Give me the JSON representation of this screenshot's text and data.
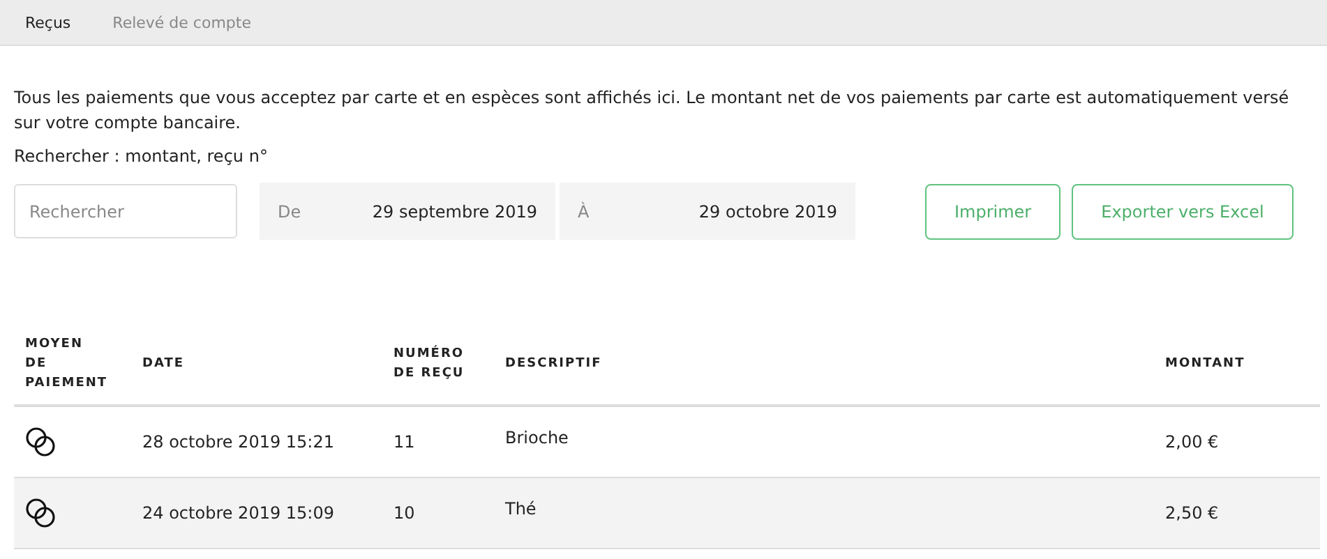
{
  "tabs": [
    {
      "label": "Reçus",
      "selected": true
    },
    {
      "label": "Relevé de compte",
      "selected": false
    }
  ],
  "intro": "Tous les paiements que vous acceptez par carte et en espèces sont affichés ici. Le montant net de vos paiements par carte est automatiquement versé sur votre compte bancaire.",
  "search_label": "Rechercher : montant, reçu n°",
  "search": {
    "placeholder": "Rechercher"
  },
  "date_from": {
    "label": "De",
    "value": "29 septembre 2019"
  },
  "date_to": {
    "label": "À",
    "value": "29 octobre 2019"
  },
  "buttons": [
    "Imprimer",
    "Exporter vers Excel"
  ],
  "table": {
    "columns": [
      "MOYEN DE PAIEMENT",
      "DATE",
      "NUMÉRO DE REÇU",
      "DESCRIPTIF",
      "MONTANT"
    ],
    "rows": [
      {
        "date": "28 octobre 2019 15:21",
        "number": "11",
        "description": "Brioche",
        "amount": "2,00 €",
        "highlighted": false
      },
      {
        "date": "24 octobre 2019 15:09",
        "number": "10",
        "description": "Thé",
        "amount": "2,50 €",
        "highlighted": true
      }
    ]
  }
}
